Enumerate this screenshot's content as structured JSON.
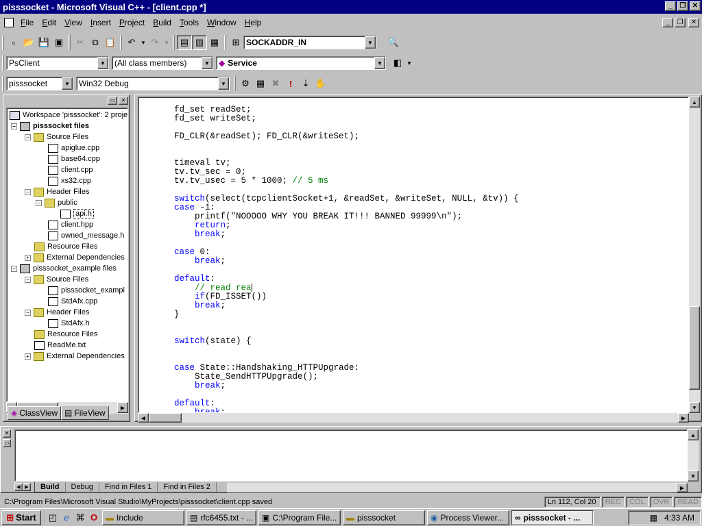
{
  "title": "pisssocket - Microsoft Visual C++ - [client.cpp *]",
  "menu": [
    "File",
    "Edit",
    "View",
    "Insert",
    "Project",
    "Build",
    "Tools",
    "Window",
    "Help"
  ],
  "toolbar1": {
    "find_combo": "SOCKADDR_IN"
  },
  "toolbar2": {
    "class_combo": "PsClient",
    "filter_combo": "(All class members)",
    "member_combo": "Service"
  },
  "toolbar3": {
    "project_combo": "pisssocket",
    "config_combo": "Win32 Debug"
  },
  "workspace": {
    "tree": [
      {
        "label": "Workspace 'pisssocket': 2 proje",
        "icon": "workspace-icon",
        "bold": false
      },
      {
        "label": "pisssocket files",
        "icon": "project-icon",
        "bold": true
      },
      {
        "label": "Source Files",
        "icon": "folder-icon"
      },
      {
        "label": "apiglue.cpp",
        "icon": "file-icon"
      },
      {
        "label": "base64.cpp",
        "icon": "file-icon"
      },
      {
        "label": "client.cpp",
        "icon": "file-icon"
      },
      {
        "label": "xs32.cpp",
        "icon": "file-icon"
      },
      {
        "label": "Header Files",
        "icon": "folder-icon"
      },
      {
        "label": "public",
        "icon": "folder-icon"
      },
      {
        "label": "api.h",
        "icon": "file-icon"
      },
      {
        "label": "client.hpp",
        "icon": "file-icon"
      },
      {
        "label": "owned_message.h",
        "icon": "file-icon"
      },
      {
        "label": "Resource Files",
        "icon": "folder-icon"
      },
      {
        "label": "External Dependencies",
        "icon": "folder-icon"
      },
      {
        "label": "pisssocket_example files",
        "icon": "project-icon"
      },
      {
        "label": "Source Files",
        "icon": "folder-icon"
      },
      {
        "label": "pisssocket_exampl",
        "icon": "file-icon"
      },
      {
        "label": "StdAfx.cpp",
        "icon": "file-icon"
      },
      {
        "label": "Header Files",
        "icon": "folder-icon"
      },
      {
        "label": "StdAfx.h",
        "icon": "file-icon"
      },
      {
        "label": "Resource Files",
        "icon": "folder-icon"
      },
      {
        "label": "ReadMe.txt",
        "icon": "file-icon"
      },
      {
        "label": "External Dependencies",
        "icon": "folder-icon"
      }
    ],
    "tabs": [
      "ClassView",
      "FileView"
    ]
  },
  "code": {
    "l1": "fd_set readSet;",
    "l2": "fd_set writeSet;",
    "l3": "FD_CLR(&readSet); FD_CLR(&writeSet);",
    "l4": "timeval tv;",
    "l5": "tv.tv_sec = 0;",
    "l6a": "tv.tv_usec = 5 * 1000; ",
    "l6b": "// 5 ms",
    "l7a": "switch",
    "l7b": "(select(tcpclientSocket+1, &readSet, &writeSet, NULL, &tv)) {",
    "l8a": "case",
    "l8b": " -1:",
    "l9": "    printf(\"NOOOOO WHY YOU BREAK IT!!! BANNED 99999\\n\");",
    "l10": "return",
    "l11": "break",
    "l12a": "case",
    "l12b": " 0:",
    "l13": "break",
    "l14": "default",
    "l15": "// read rea",
    "l16a": "if",
    "l16b": "(FD_ISSET())",
    "l17": "break",
    "l18": "}",
    "l19a": "switch",
    "l19b": "(state) {",
    "l20a": "case",
    "l20b": " State::Handshaking_HTTPUpgrade:",
    "l21": "    State_SendHTTPUpgrade();",
    "l22": "break",
    "l23": "default",
    "l24": "break"
  },
  "output": {
    "tabs": [
      "Build",
      "Debug",
      "Find in Files 1",
      "Find in Files 2"
    ]
  },
  "status": {
    "message": "C:\\Program Files\\Microsoft Visual Studio\\MyProjects\\pisssocket\\client.cpp saved",
    "position": "Ln 112, Col 20",
    "rec": "REC",
    "col": "COL",
    "ovr": "OVR",
    "read": "READ"
  },
  "taskbar": {
    "start": "Start",
    "tasks": [
      "Include",
      "rfc6455.txt - ...",
      "C:\\Program File...",
      "pisssocket",
      "Process Viewer...",
      "pisssocket - ..."
    ],
    "clock": "4:33 AM"
  }
}
